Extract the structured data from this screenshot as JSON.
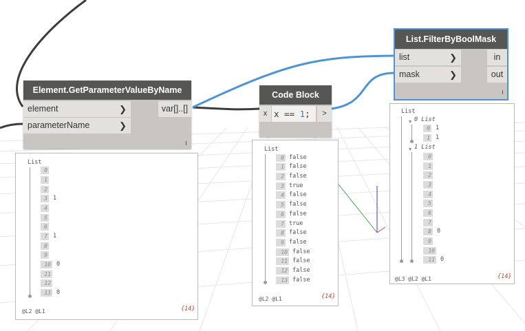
{
  "nodes": {
    "get_param": {
      "title": "Element.GetParameterValueByName",
      "inputs": [
        "element",
        "parameterName"
      ],
      "output": "var[]..[]",
      "preview": {
        "title": "List",
        "items": [
          {
            "i": "0",
            "v": ""
          },
          {
            "i": "1",
            "v": ""
          },
          {
            "i": "2",
            "v": ""
          },
          {
            "i": "3",
            "v": "1"
          },
          {
            "i": "4",
            "v": ""
          },
          {
            "i": "5",
            "v": ""
          },
          {
            "i": "6",
            "v": ""
          },
          {
            "i": "7",
            "v": "1"
          },
          {
            "i": "8",
            "v": ""
          },
          {
            "i": "9",
            "v": ""
          },
          {
            "i": "10",
            "v": "0"
          },
          {
            "i": "11",
            "v": ""
          },
          {
            "i": "12",
            "v": ""
          },
          {
            "i": "13",
            "v": "0"
          }
        ],
        "levels": "@L2 @L1",
        "count": "{14}"
      }
    },
    "code_block": {
      "title": "Code Block",
      "input": "x",
      "code_prefix": "x == ",
      "code_number": "1",
      "code_suffix": ";",
      "output": ">",
      "preview": {
        "title": "List",
        "items": [
          {
            "i": "0",
            "v": "false"
          },
          {
            "i": "1",
            "v": "false"
          },
          {
            "i": "2",
            "v": "false"
          },
          {
            "i": "3",
            "v": "true"
          },
          {
            "i": "4",
            "v": "false"
          },
          {
            "i": "5",
            "v": "false"
          },
          {
            "i": "6",
            "v": "false"
          },
          {
            "i": "7",
            "v": "true"
          },
          {
            "i": "8",
            "v": "false"
          },
          {
            "i": "9",
            "v": "false"
          },
          {
            "i": "10",
            "v": "false"
          },
          {
            "i": "11",
            "v": "false"
          },
          {
            "i": "12",
            "v": "false"
          },
          {
            "i": "13",
            "v": "false"
          }
        ],
        "levels": "@L2 @L1",
        "count": "{14}"
      }
    },
    "filter": {
      "title": "List.FilterByBoolMask",
      "inputs": [
        "list",
        "mask"
      ],
      "outputs": [
        "in",
        "out"
      ],
      "preview": {
        "title": "List",
        "sub0": {
          "label": "0 List",
          "items": [
            {
              "i": "0",
              "v": "1"
            },
            {
              "i": "1",
              "v": "1"
            }
          ]
        },
        "sub1": {
          "label": "1 List",
          "items": [
            {
              "i": "0",
              "v": ""
            },
            {
              "i": "1",
              "v": ""
            },
            {
              "i": "2",
              "v": ""
            },
            {
              "i": "3",
              "v": ""
            },
            {
              "i": "4",
              "v": ""
            },
            {
              "i": "5",
              "v": ""
            },
            {
              "i": "6",
              "v": ""
            },
            {
              "i": "7",
              "v": ""
            },
            {
              "i": "8",
              "v": "0"
            },
            {
              "i": "9",
              "v": ""
            },
            {
              "i": "10",
              "v": ""
            },
            {
              "i": "11",
              "v": "0"
            }
          ]
        },
        "levels": "@L3 @L2 @L1",
        "count": "{14}"
      }
    }
  },
  "colors": {
    "wire_selected": "#4c94d6",
    "wire_default": "#3c3c3c",
    "node_header": "#565655",
    "node_body": "#c9c6c1",
    "code_number": "#2f7bd0"
  }
}
